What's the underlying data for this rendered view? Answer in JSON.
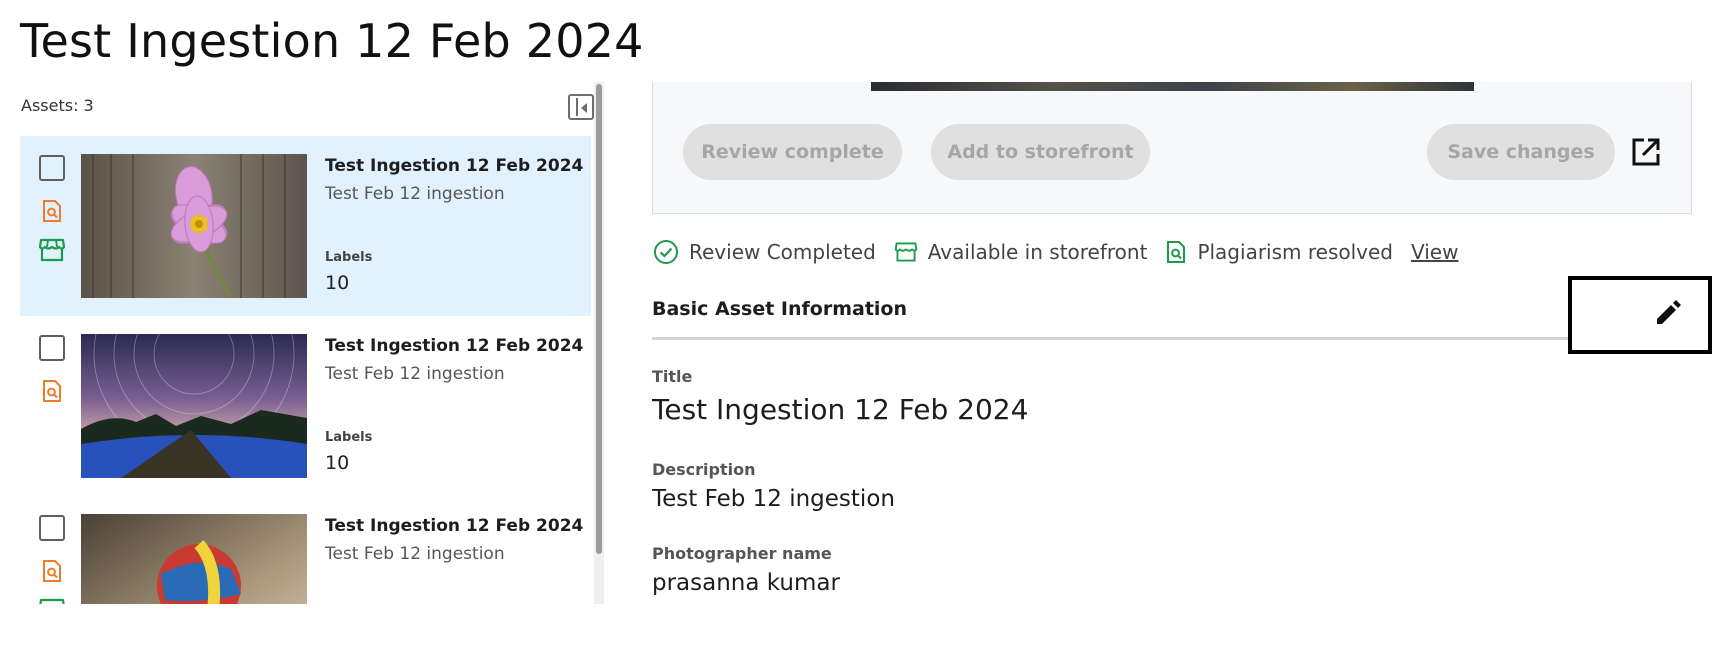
{
  "page": {
    "title": "Test Ingestion 12 Feb 2024"
  },
  "left_panel": {
    "assets_count": "Assets: 3",
    "assets": [
      {
        "title": "Test Ingestion 12 Feb 2024",
        "description": "Test Feb 12 ingestion",
        "labels_caption": "Labels",
        "labels_count": "10",
        "selected": true,
        "icons": [
          "plagiarism-icon",
          "storefront-icon"
        ],
        "thumbnail": "pink cosmos flower"
      },
      {
        "title": "Test Ingestion 12 Feb 2024",
        "description": "Test Feb 12 ingestion",
        "labels_caption": "Labels",
        "labels_count": "10",
        "selected": false,
        "icons": [
          "plagiarism-icon"
        ],
        "thumbnail": "star trails over glowing field"
      },
      {
        "title": "Test Ingestion 12 Feb 2024",
        "description": "Test Feb 12 ingestion",
        "labels_caption": "",
        "labels_count": "",
        "selected": false,
        "icons": [
          "plagiarism-icon",
          "storefront-icon"
        ],
        "thumbnail": "juggling balls"
      }
    ]
  },
  "actions": {
    "review_complete": "Review complete",
    "add_to_storefront": "Add to storefront",
    "save_changes": "Save changes"
  },
  "status": {
    "review": "Review Completed",
    "storefront": "Available in storefront",
    "plagiarism": "Plagiarism resolved",
    "view_link": "View"
  },
  "basic_info": {
    "header": "Basic Asset Information",
    "title_label": "Title",
    "title_value": "Test Ingestion 12 Feb 2024",
    "description_label": "Description",
    "description_value": "Test Feb 12 ingestion",
    "photographer_label": "Photographer name",
    "photographer_value": "prasanna kumar"
  },
  "colors": {
    "selected_row": "#e1f1fd",
    "plagiarism_orange": "#f07c2a",
    "storefront_green": "#1e9b4a",
    "disabled_button": "#e0e0e0"
  }
}
